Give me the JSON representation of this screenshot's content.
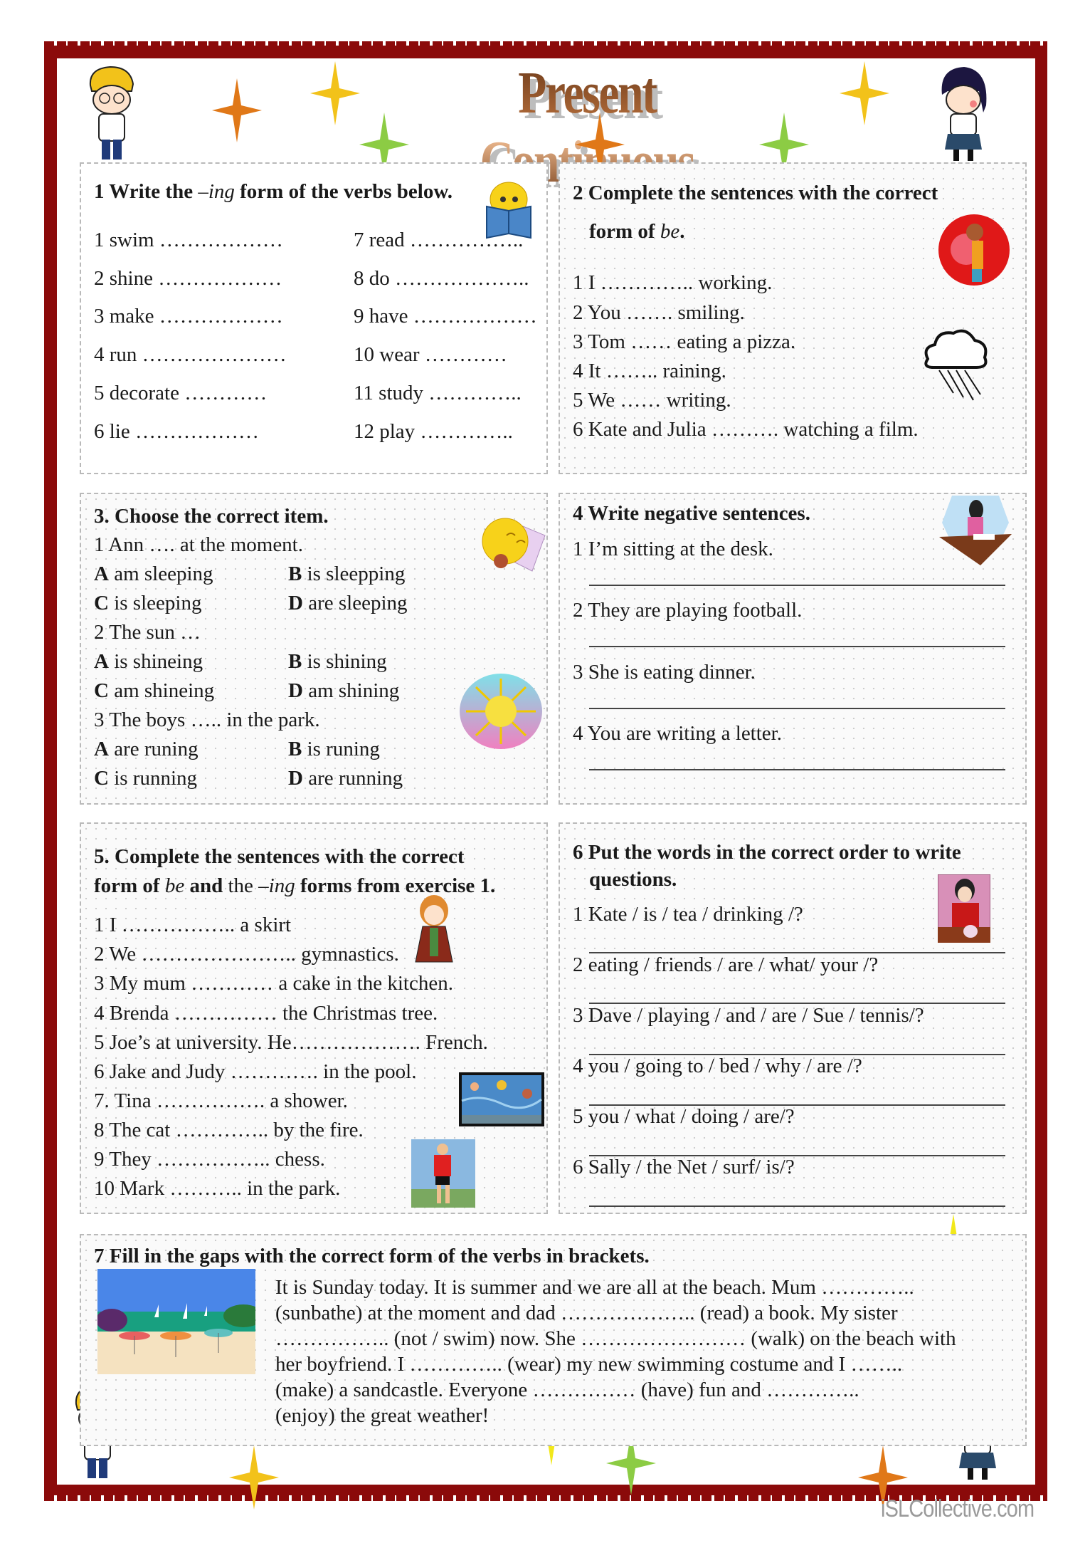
{
  "title": "Present Continuous",
  "colors": {
    "frame": "#8b0a0a",
    "title": "#8a4a22",
    "star_orange": "#e07818",
    "star_yellow": "#f2c21a",
    "star_green": "#8ccc44"
  },
  "ex1": {
    "heading_pre": "1 Write the ",
    "heading_ing": "–ing",
    "heading_post": " form of the verbs below.",
    "left": [
      "1 swim ………………",
      "2 shine ………………",
      "3 make ………………",
      "4 run …………………",
      "5 decorate …………",
      "6 lie ………………"
    ],
    "right": [
      "7 read ……………..",
      "8 do ………………..",
      "9 have ………………",
      "10 wear …………",
      "11 study …………..",
      "12 play ………….."
    ],
    "icon": "reading-smiley-icon"
  },
  "ex2": {
    "heading_line1": "2 Complete the sentences with the correct",
    "heading_line2_pre": "form of ",
    "heading_line2_be": "be",
    "heading_line2_post": ".",
    "items": [
      "1 I ………….. working.",
      "2 You ……. smiling.",
      "3 Tom …… eating a pizza.",
      "4 It …….. raining.",
      "5 We …… writing.",
      "6 Kate and Julia ………. watching a film."
    ],
    "icons": [
      "boy-eating-pizza-icon",
      "rain-cloud-icon"
    ]
  },
  "ex3": {
    "heading": "3. Choose the correct item.",
    "questions": [
      {
        "q": "1 Ann …. at the moment.",
        "options": [
          {
            "letter": "A",
            "text": " am sleeping"
          },
          {
            "letter": "B",
            "text": " is sleepping"
          },
          {
            "letter": "C",
            "text": " is sleeping"
          },
          {
            "letter": "D",
            "text": " are sleeping"
          }
        ]
      },
      {
        "q": "2 The sun …",
        "options": [
          {
            "letter": "A",
            "text": " is shineing"
          },
          {
            "letter": "B",
            "text": " is shining"
          },
          {
            "letter": "C",
            "text": " am shineing"
          },
          {
            "letter": "D",
            "text": " am shining"
          }
        ]
      },
      {
        "q": "3 The boys ….. in the park.",
        "options": [
          {
            "letter": "A",
            "text": " are runing"
          },
          {
            "letter": "B",
            "text": " is runing"
          },
          {
            "letter": "C",
            "text": " is running"
          },
          {
            "letter": "D",
            "text": " are running"
          }
        ]
      }
    ],
    "icons": [
      "sleeping-moon-icon",
      "sun-icon"
    ]
  },
  "ex4": {
    "heading": "4 Write negative sentences.",
    "items": [
      "1 I’m sitting at the desk.",
      "2 They are playing football.",
      "3 She is eating dinner.",
      "4 You are writing a letter."
    ],
    "icon": "girl-at-desk-icon"
  },
  "ex5": {
    "heading_line1": "5. Complete the sentences with the correct",
    "heading_line2_a": "form of ",
    "heading_line2_be": "be",
    "heading_line2_b": " and ",
    "heading_line2_the": "the ",
    "heading_line2_ing": "–ing",
    "heading_line2_c": " forms from exercise 1.",
    "items": [
      "1 I …………….. a skirt",
      "2 We ………………….. gymnastics.",
      "3 My mum ………… a cake in the kitchen.",
      "4 Brenda …………… the Christmas tree.",
      "5 Joe’s at university. He………………. French.",
      "6 Jake and Judy …………. in the pool.",
      "7. Tina ……………. a shower.",
      "8 The cat ………….. by the fire.",
      "9 They …………….. chess.",
      "10 Mark ……….. in the park."
    ],
    "icons": [
      "girl-in-dress-icon",
      "swimmers-icon",
      "runner-icon"
    ]
  },
  "ex6": {
    "heading_line1": "6 Put the words in the correct order to write",
    "heading_line2": "questions.",
    "items": [
      "1 Kate / is / tea / drinking /?",
      "2 eating / friends / are / what/ your /?",
      "3 Dave / playing / and / are / Sue / tennis/?",
      "4 you / going to / bed / why / are /?",
      "5 you / what / doing / are/?",
      "6 Sally / the Net / surf/ is/?"
    ],
    "icon": "woman-drinking-tea-icon"
  },
  "ex7": {
    "heading": "7 Fill in the gaps with the correct form of the verbs in brackets.",
    "lines": [
      "It is Sunday today. It is summer and we are all at the beach. Mum …………..",
      "(sunbathe) at the moment and dad ……………….. (read) a book. My sister",
      "…………….. (not / swim) now. She …………………… (walk) on the beach with",
      "her boyfriend. I ………….. (wear) my new swimming costume and I ……..",
      "(make) a sandcastle. Everyone …………… (have) fun and …………..",
      "(enjoy) the great weather!"
    ],
    "icon": "beach-scene-icon"
  },
  "watermark": "iSLCollective.com"
}
